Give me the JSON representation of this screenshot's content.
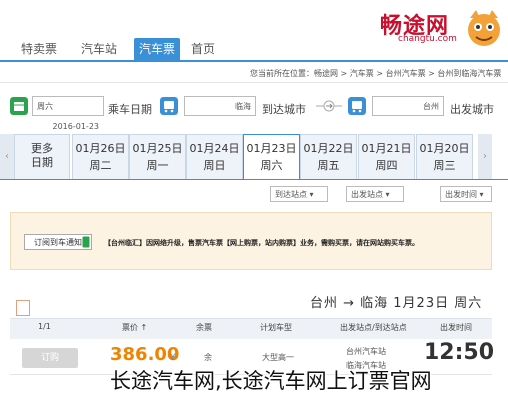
{
  "logo": {
    "text": "畅途网",
    "sub": "changtu.com"
  },
  "nav": {
    "items": [
      {
        "label": "首页"
      },
      {
        "label": "汽车票"
      },
      {
        "label": "汽车站"
      },
      {
        "label": "特卖票"
      }
    ]
  },
  "breadcrumb": "您当前所在位置：畅途网 > 汽车票 > 台州汽车票 > 台州到临海汽车票",
  "search": {
    "from_label": "出发城市",
    "from_value": "台州",
    "to_label": "到达城市",
    "to_value": "临海",
    "date_label": "乘车日期",
    "date_value": "2016-01-23",
    "weekday_value": "周六"
  },
  "date_tabs": [
    {
      "date": "01月20日",
      "day": "周三"
    },
    {
      "date": "01月21日",
      "day": "周四"
    },
    {
      "date": "01月22日",
      "day": "周五"
    },
    {
      "date": "01月23日",
      "day": "周六"
    },
    {
      "date": "01月24日",
      "day": "周日"
    },
    {
      "date": "01月25日",
      "day": "周一"
    },
    {
      "date": "01月26日",
      "day": "周二"
    }
  ],
  "more_dates": "更多日期",
  "filters": {
    "depart_time": "出发时间",
    "depart_station": "出发站点",
    "arrive_station": "到达站点"
  },
  "notice": {
    "text": "【台州临汇】因网络升级，售票汽车票【网上购票，站内购票】业务，需购买票，请在网站购买车票。",
    "button": "订阅到车通知"
  },
  "route_title": "台州 → 临海  1月23日  周六",
  "table": {
    "headers": [
      "出发时间",
      "出发站点/到达站点",
      "计划车型",
      "票价",
      "票价 ↑",
      "余票",
      "1/1"
    ],
    "row": {
      "time": "12:50",
      "depart_station": "台州汽车站",
      "arrive_station": "临海汽车站",
      "vehicle": "大型高一",
      "remaining": "余",
      "price": "386.00",
      "book": "订购"
    }
  },
  "watermark": "长途汽车网,长途汽车网上订票官网",
  "colors": {
    "accent": "#3a8fd6",
    "brand": "#c8102e",
    "price": "#f08400"
  }
}
